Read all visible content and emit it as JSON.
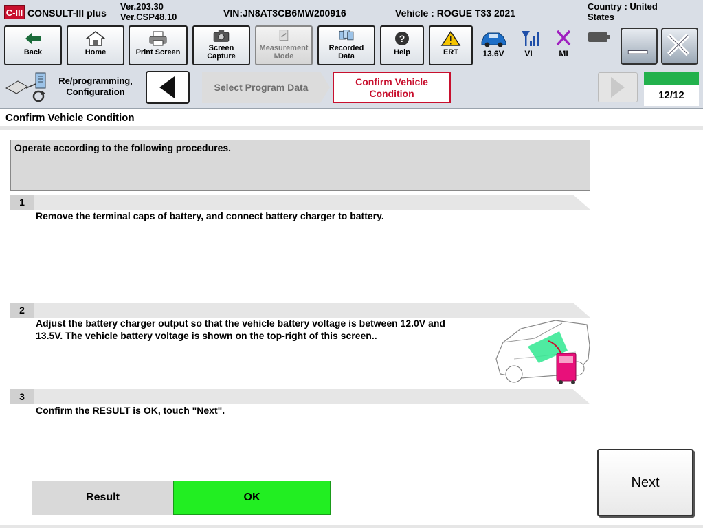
{
  "titlebar": {
    "logo": "C-III",
    "app_name": "CONSULT-III plus",
    "version_line1": "Ver.203.30",
    "version_line2": "Ver.CSP48.10",
    "vin": "VIN:JN8AT3CB6MW200916",
    "vehicle": "Vehicle : ROGUE T33 2021",
    "country_line1": "Country : United",
    "country_line2": "States"
  },
  "toolbar": {
    "buttons": [
      {
        "label": "Back",
        "icon": "back-arrow-icon"
      },
      {
        "label": "Home",
        "icon": "home-icon"
      },
      {
        "label": "Print Screen",
        "icon": "printer-icon"
      },
      {
        "label_line1": "Screen",
        "label_line2": "Capture",
        "icon": "camera-icon"
      },
      {
        "label_line1": "Measurement",
        "label_line2": "Mode",
        "icon": "measurement-icon",
        "disabled": true
      },
      {
        "label_line1": "Recorded",
        "label_line2": "Data",
        "icon": "recorded-data-icon"
      },
      {
        "label": "Help",
        "icon": "help-icon"
      },
      {
        "label": "ERT",
        "icon": "warning-icon"
      }
    ],
    "status": {
      "battery_voltage": "13.6V",
      "vi_label": "VI",
      "mi_label": "MI"
    }
  },
  "nav": {
    "category_line1": "Re/programming,",
    "category_line2": "Configuration",
    "step_inactive": "Select Program Data",
    "step_active_line1": "Confirm Vehicle",
    "step_active_line2": "Condition",
    "progress": "12/12"
  },
  "page": {
    "title": "Confirm Vehicle Condition",
    "instruction": "Operate according to the following procedures."
  },
  "steps": [
    {
      "num": "1",
      "text": "Remove the terminal caps of battery, and connect battery charger to battery."
    },
    {
      "num": "2",
      "text_line1": "Adjust the battery charger output so that the vehicle battery voltage is between 12.0V and",
      "text_line2": "13.5V. The vehicle battery voltage is shown on the top-right of this screen.."
    },
    {
      "num": "3",
      "text": "Confirm the RESULT is OK, touch \"Next\"."
    }
  ],
  "result": {
    "label": "Result",
    "value": "OK"
  },
  "next_label": "Next",
  "colors": {
    "accent_red": "#c8102e",
    "progress_green": "#22b14c",
    "ok_green": "#22ee22",
    "mi_purple": "#a020c0",
    "vehicle_blue": "#1e6fc8"
  }
}
